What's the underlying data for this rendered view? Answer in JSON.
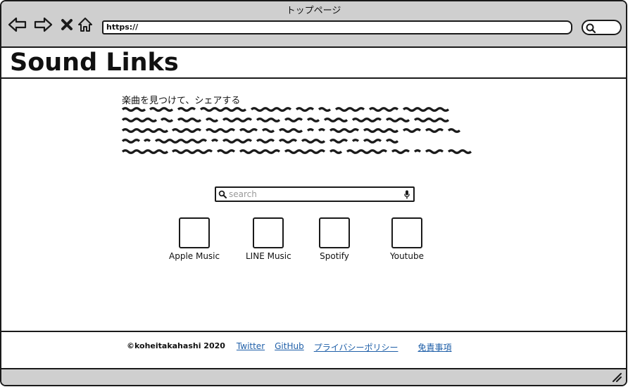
{
  "browser": {
    "window_title": "トップページ",
    "url": "https://"
  },
  "header": {
    "title": "Sound Links"
  },
  "main": {
    "lead": "楽曲を見つけて、シェアする",
    "search": {
      "placeholder": "search"
    },
    "services": [
      {
        "label": "Apple Music"
      },
      {
        "label": "LINE Music"
      },
      {
        "label": "Spotify"
      },
      {
        "label": "Youtube"
      }
    ]
  },
  "footer": {
    "copyright": "©koheitakahashi 2020",
    "links": {
      "twitter": "Twitter",
      "github": "GitHub",
      "privacy": "プライバシーポリシー",
      "disclaimer": "免責事項"
    }
  },
  "colors": {
    "chrome": "#cfcfcf",
    "link": "#1f5fa8",
    "border": "#1a1a1a"
  }
}
